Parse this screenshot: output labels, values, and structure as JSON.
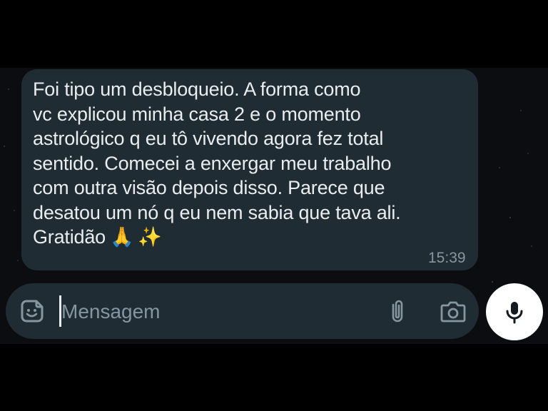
{
  "message": {
    "lines": [
      "Foi tipo um desbloqueio. A forma como",
      "vc explicou minha casa 2 e o momento",
      "astrológico q eu tô vivendo agora fez total",
      "sentido. Comecei a enxergar meu trabalho",
      "com outra visão depois disso. Parece que",
      "desatou um nó q eu nem sabia que tava ali."
    ],
    "last_line": "Gratidão",
    "emoji_pray": "🙏",
    "emoji_sparkles": "✨",
    "time": "15:39"
  },
  "composer": {
    "placeholder": "Mensagem",
    "icons": {
      "sticker": "sticker-icon",
      "attach": "paperclip-icon",
      "camera": "camera-icon",
      "mic": "microphone-icon"
    }
  },
  "colors": {
    "bubble": "#202c33",
    "composer": "#1f2c34",
    "text": "#e9edef",
    "muted": "#8696a0"
  }
}
